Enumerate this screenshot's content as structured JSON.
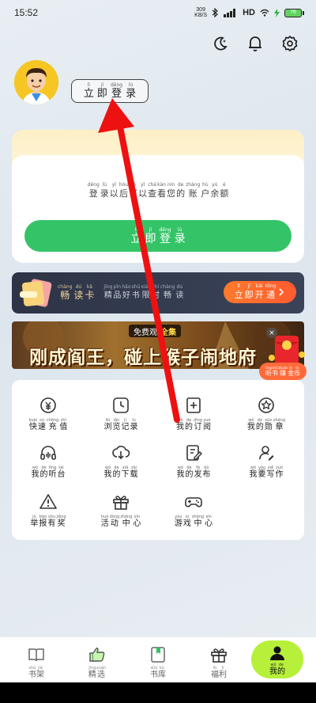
{
  "status_bar": {
    "time": "15:52",
    "speed": "309",
    "speed_unit": "KB/S",
    "network": "HD",
    "battery": "76"
  },
  "login": {
    "button": [
      {
        "p": "lì",
        "h": "立"
      },
      {
        "p": "jí",
        "h": "即"
      },
      {
        "p": "dēng",
        "h": "登"
      },
      {
        "p": "lù",
        "h": "录"
      }
    ]
  },
  "balance": {
    "text": [
      {
        "p": "dēng",
        "h": "登"
      },
      {
        "p": "lù",
        "h": "录"
      },
      {
        "p": "yǐ",
        "h": "以"
      },
      {
        "p": "hòu",
        "h": "后"
      },
      {
        "p": "kě",
        "h": "可"
      },
      {
        "p": "yǐ",
        "h": "以"
      },
      {
        "p": "chá",
        "h": "查"
      },
      {
        "p": "kàn",
        "h": "看"
      },
      {
        "p": "nín",
        "h": "您"
      },
      {
        "p": "de",
        "h": "的"
      },
      {
        "p": "zhàng",
        "h": "账"
      },
      {
        "p": "hù",
        "h": "户"
      },
      {
        "p": "yú",
        "h": "余"
      },
      {
        "p": "é",
        "h": "额"
      }
    ],
    "button": [
      {
        "p": "lì",
        "h": "立"
      },
      {
        "p": "jí",
        "h": "即"
      },
      {
        "p": "dēng",
        "h": "登"
      },
      {
        "p": "lù",
        "h": "录"
      }
    ]
  },
  "vip": {
    "title": [
      {
        "p": "chàng",
        "h": "畅"
      },
      {
        "p": "dú",
        "h": "读"
      },
      {
        "p": "kǎ",
        "h": "卡"
      }
    ],
    "desc": [
      {
        "p": "jīng",
        "h": "精"
      },
      {
        "p": "pǐn",
        "h": "品"
      },
      {
        "p": "hǎo",
        "h": "好"
      },
      {
        "p": "shū",
        "h": "书"
      },
      {
        "p": "xiàn",
        "h": "限"
      },
      {
        "p": "shí",
        "h": "时"
      },
      {
        "p": "chàng",
        "h": "畅"
      },
      {
        "p": "dú",
        "h": "读"
      }
    ],
    "button": [
      {
        "p": "lì",
        "h": "立"
      },
      {
        "p": "jí",
        "h": "即"
      },
      {
        "p": "kāi",
        "h": "开"
      },
      {
        "p": "tōng",
        "h": "通"
      }
    ]
  },
  "ad": {
    "tag_prefix": "免费观",
    "tag_highlight": "全集",
    "headline": "刚成阎王，碰上猴子闹地府"
  },
  "redpacket": {
    "label": [
      {
        "p": "tīng",
        "h": "听"
      },
      {
        "p": "shū",
        "h": "书"
      },
      {
        "p": "zhuàn",
        "h": "赚"
      },
      {
        "p": "jīn",
        "h": "金"
      },
      {
        "p": "bì",
        "h": "币"
      }
    ]
  },
  "grid": [
    {
      "icon": "yuan-clock-icon",
      "label": [
        {
          "p": "kuài",
          "h": "快"
        },
        {
          "p": "sù",
          "h": "速"
        },
        {
          "p": "chōng",
          "h": "充"
        },
        {
          "p": "zhí",
          "h": "值"
        }
      ]
    },
    {
      "icon": "clock-icon",
      "label": [
        {
          "p": "liú",
          "h": "浏"
        },
        {
          "p": "lǎn",
          "h": "览"
        },
        {
          "p": "jì",
          "h": "记"
        },
        {
          "p": "lù",
          "h": "录"
        }
      ]
    },
    {
      "icon": "plus-square-icon",
      "label": [
        {
          "p": "wǒ",
          "h": "我"
        },
        {
          "p": "de",
          "h": "的"
        },
        {
          "p": "dìng",
          "h": "订"
        },
        {
          "p": "yuè",
          "h": "阅"
        }
      ]
    },
    {
      "icon": "medal-icon",
      "label": [
        {
          "p": "wǒ",
          "h": "我"
        },
        {
          "p": "de",
          "h": "的"
        },
        {
          "p": "xūn",
          "h": "勋"
        },
        {
          "p": "zhāng",
          "h": "章"
        }
      ]
    },
    {
      "icon": "headphones-icon",
      "label": [
        {
          "p": "wǒ",
          "h": "我"
        },
        {
          "p": "de",
          "h": "的"
        },
        {
          "p": "tīng",
          "h": "听"
        },
        {
          "p": "tái",
          "h": "台"
        }
      ]
    },
    {
      "icon": "download-icon",
      "label": [
        {
          "p": "wǒ",
          "h": "我"
        },
        {
          "p": "de",
          "h": "的"
        },
        {
          "p": "xià",
          "h": "下"
        },
        {
          "p": "zài",
          "h": "载"
        }
      ]
    },
    {
      "icon": "edit-icon",
      "label": [
        {
          "p": "wǒ",
          "h": "我"
        },
        {
          "p": "de",
          "h": "的"
        },
        {
          "p": "fā",
          "h": "发"
        },
        {
          "p": "bù",
          "h": "布"
        }
      ]
    },
    {
      "icon": "writer-icon",
      "label": [
        {
          "p": "wǒ",
          "h": "我"
        },
        {
          "p": "yào",
          "h": "要"
        },
        {
          "p": "xiě",
          "h": "写"
        },
        {
          "p": "zuò",
          "h": "作"
        }
      ]
    },
    {
      "icon": "warning-icon",
      "label": [
        {
          "p": "jǔ",
          "h": "举"
        },
        {
          "p": "bào",
          "h": "报"
        },
        {
          "p": "yǒu",
          "h": "有"
        },
        {
          "p": "jiǎng",
          "h": "奖"
        }
      ]
    },
    {
      "icon": "gift-icon",
      "label": [
        {
          "p": "huó",
          "h": "活"
        },
        {
          "p": "dòng",
          "h": "动"
        },
        {
          "p": "zhōng",
          "h": "中"
        },
        {
          "p": "xīn",
          "h": "心"
        }
      ]
    },
    {
      "icon": "gamepad-icon",
      "label": [
        {
          "p": "yóu",
          "h": "游"
        },
        {
          "p": "xì",
          "h": "戏"
        },
        {
          "p": "zhōng",
          "h": "中"
        },
        {
          "p": "xīn",
          "h": "心"
        }
      ]
    }
  ],
  "nav": [
    {
      "icon": "book-icon",
      "label": [
        {
          "p": "shū",
          "h": "书"
        },
        {
          "p": "jià",
          "h": "架"
        }
      ]
    },
    {
      "icon": "thumb-up-icon",
      "label": [
        {
          "p": "jīng",
          "h": "精"
        },
        {
          "p": "xuǎn",
          "h": "选"
        }
      ]
    },
    {
      "icon": "bookmark-icon",
      "label": [
        {
          "p": "shū",
          "h": "书"
        },
        {
          "p": "kù",
          "h": "库"
        }
      ]
    },
    {
      "icon": "gift-icon",
      "label": [
        {
          "p": "fú",
          "h": "福"
        },
        {
          "p": "lì",
          "h": "利"
        }
      ]
    },
    {
      "icon": "user-icon",
      "label": [
        {
          "p": "wǒ",
          "h": "我"
        },
        {
          "p": "de",
          "h": "的"
        }
      ]
    }
  ],
  "colors": {
    "green": "#34c467",
    "vip_orange": "#ff6a3a",
    "nav_active": "#b7f03a",
    "arrow": "#ee1111"
  }
}
